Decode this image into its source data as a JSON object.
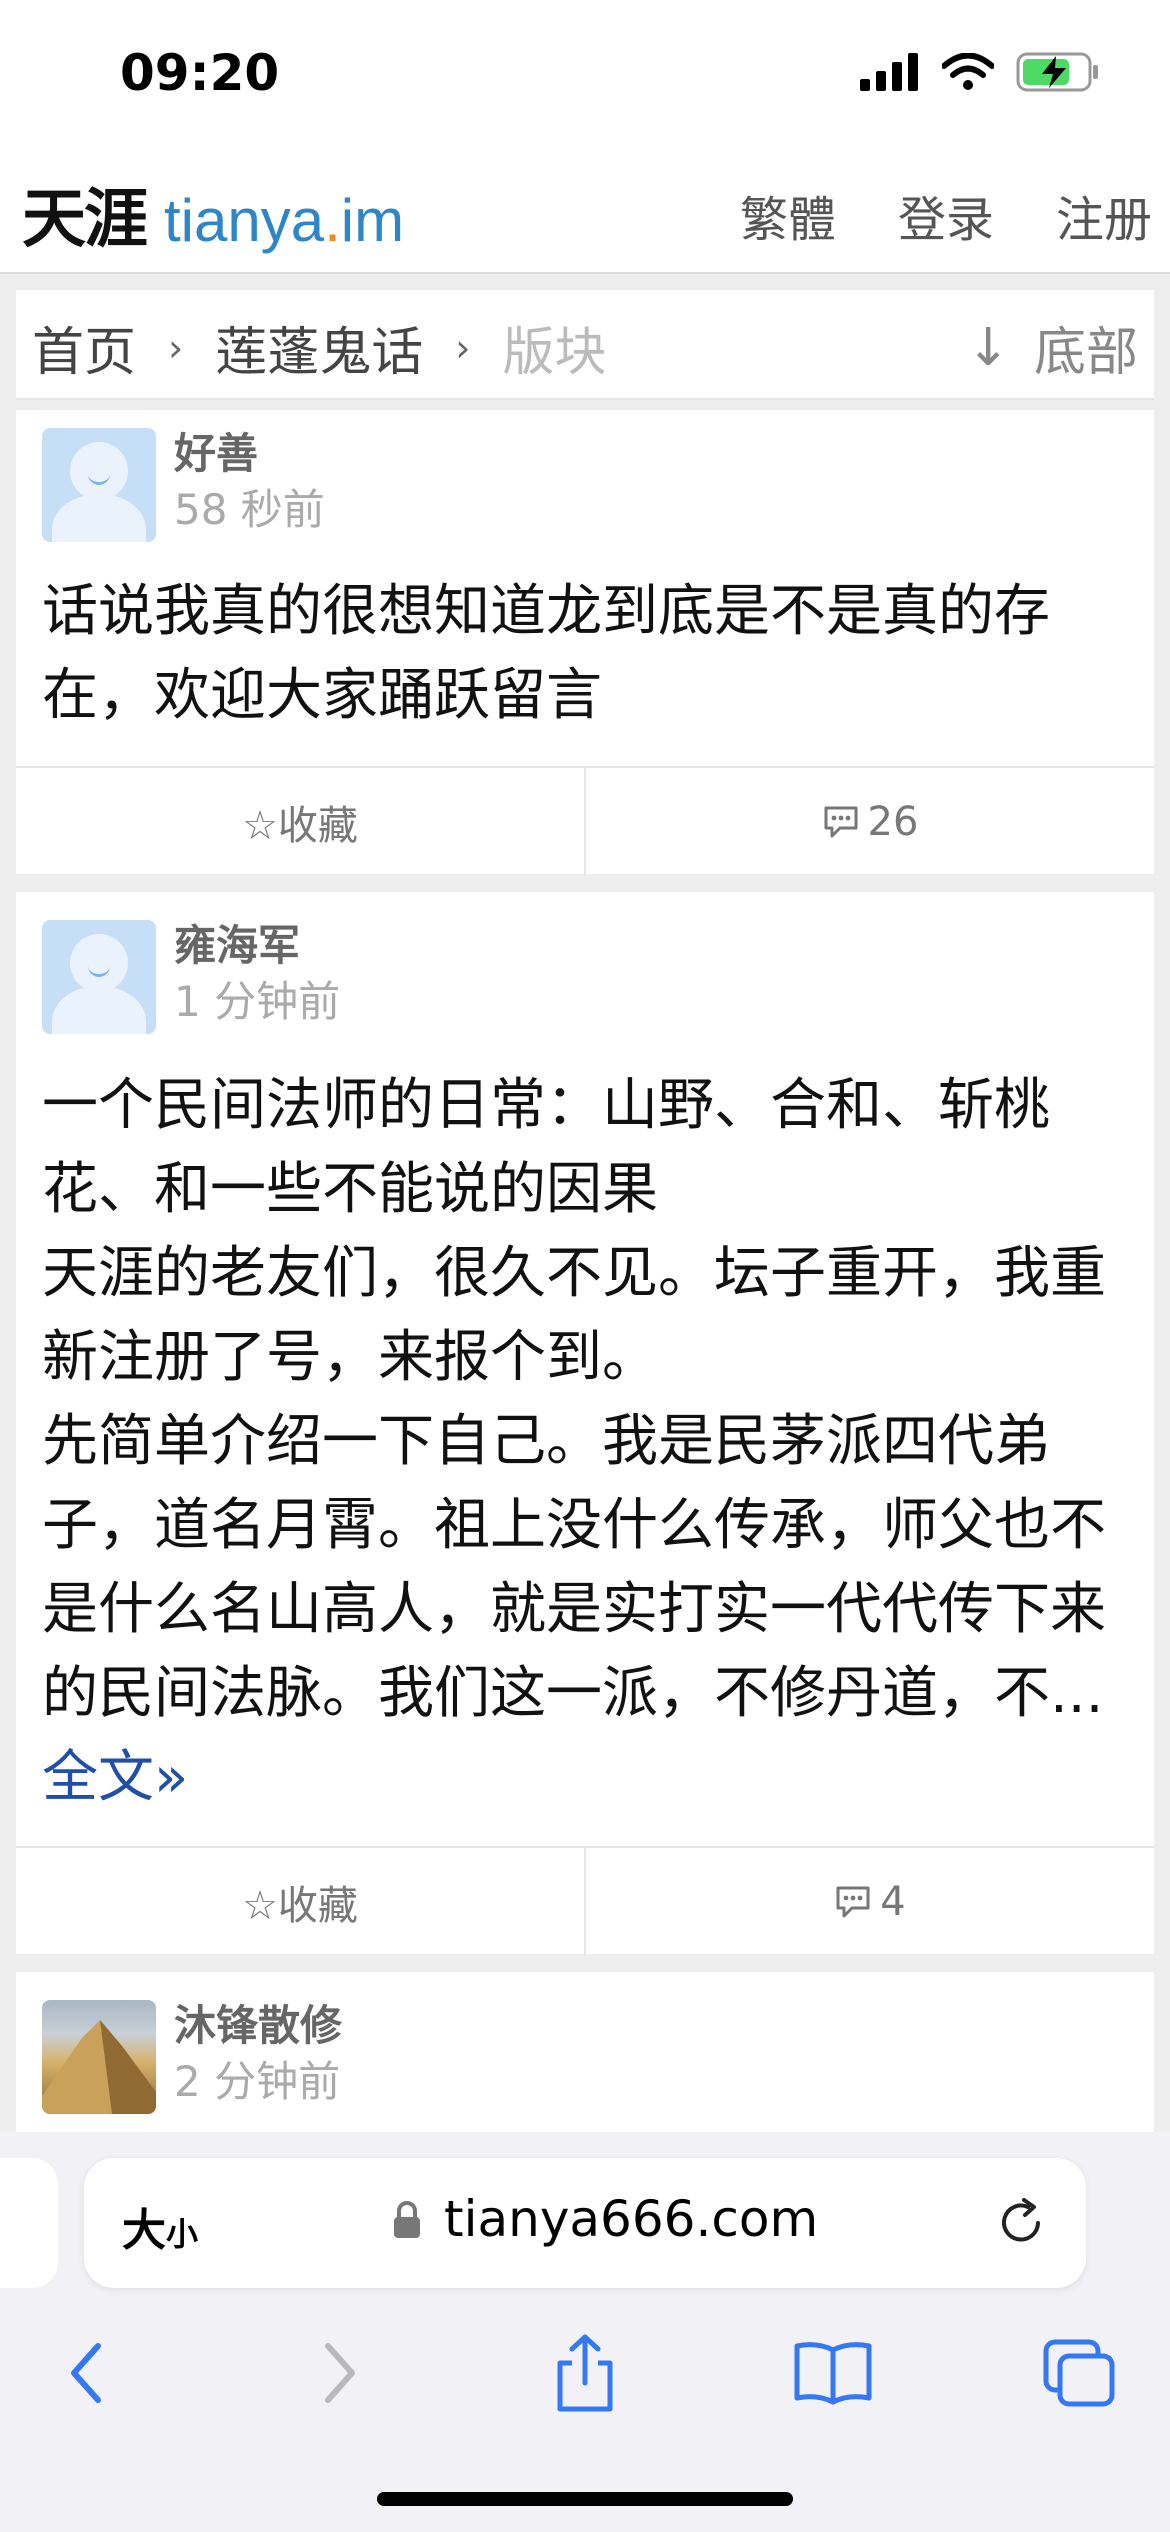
{
  "status": {
    "time": "09:20"
  },
  "header": {
    "logo_cn": "天涯",
    "logo_en_a": "tianya",
    "logo_en_dot": ".",
    "logo_en_b": "im",
    "nav": [
      "繁體",
      "登录",
      "注册"
    ]
  },
  "breadcrumb": {
    "home": "首页",
    "board": "莲蓬鬼话",
    "current": "版块",
    "sep": "›",
    "bottom_arrow": "↓",
    "bottom": "底部"
  },
  "posts": [
    {
      "user": "好善",
      "time": "58 秒前",
      "text": "话说我真的很想知道龙到底是不是真的存在，欢迎大家踊跃留言",
      "favorite": "☆收藏",
      "comments": "26"
    },
    {
      "user": "雍海军",
      "time": "1 分钟前",
      "lines": [
        "一个民间法师的日常：山野、合和、斩桃花、和一些不能说的因果",
        "天涯的老友们，很久不见。坛子重开，我重新注册了号，来报个到。",
        "先简单介绍一下自己。我是民茅派四代弟子，道名月霄。祖上没什么传承，师父也不是什么名山高人，就是实打实一代代传下来的民间法脉。我们这一派，不修丹道，不..."
      ],
      "more": "全文»",
      "favorite": "☆收藏",
      "comments": "4"
    },
    {
      "user": "沐锋散修",
      "time": "2 分钟前"
    }
  ],
  "safari": {
    "size_big": "大",
    "size_small": "小",
    "domain": "tianya666.com"
  },
  "colors": {
    "accent": "#2e86c9",
    "link": "#1f4fa8",
    "logo_dot": "#f08a1c"
  }
}
